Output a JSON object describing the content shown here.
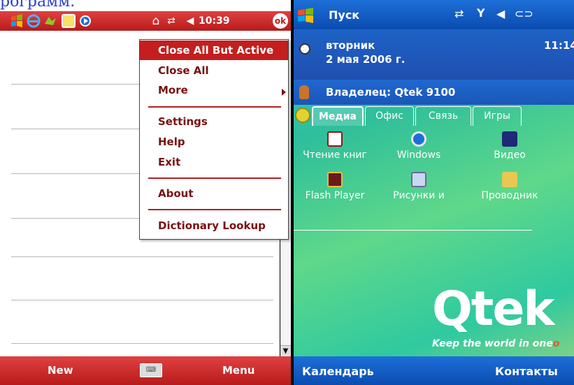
{
  "page_caption": "рограмм.",
  "left_device": {
    "status_bar": {
      "time": "10:39",
      "ok_label": "ok",
      "icons": [
        "windows-start-icon",
        "internet-explorer-icon",
        "mail-icon",
        "notes-icon",
        "media-player-icon",
        "home-icon",
        "sync-icon",
        "volume-icon"
      ]
    },
    "context_menu": {
      "items": [
        {
          "label": "Close All But Active"
        },
        {
          "label": "Close All"
        },
        {
          "label": "More"
        },
        {
          "label": "Settings"
        },
        {
          "label": "Help"
        },
        {
          "label": "Exit"
        },
        {
          "label": "About"
        },
        {
          "label": "Dictionary Lookup"
        }
      ]
    },
    "bottom_bar": {
      "left_softkey": "New",
      "right_softkey": "Menu"
    },
    "colors": {
      "accent": "#c41e1e",
      "menu_text": "#7a1010"
    }
  },
  "right_device": {
    "status_bar": {
      "start_label": "Пуск"
    },
    "today": {
      "weekday": "вторник",
      "date": "2 мая 2006 г.",
      "time": "11:14",
      "owner": "Владелец: Qtek 9100"
    },
    "tabs": [
      {
        "label": "Медиа"
      },
      {
        "label": "Офис"
      },
      {
        "label": "Связь"
      },
      {
        "label": "Игры"
      }
    ],
    "apps": [
      {
        "label": "Чтение книг",
        "icon": "book-reader-icon"
      },
      {
        "label": "Windows",
        "icon": "windows-media-icon"
      },
      {
        "label": "Видео",
        "icon": "video-icon"
      },
      {
        "label": "Flash Player",
        "icon": "flash-player-icon"
      },
      {
        "label": "Рисунки и",
        "icon": "pictures-icon"
      },
      {
        "label": "Проводник",
        "icon": "explorer-folder-icon"
      }
    ],
    "brand": {
      "logo": "Qtek",
      "slogan": "Keep the world in one",
      "slogan_mark": "o"
    },
    "bottom_bar": {
      "left_softkey": "Календарь",
      "right_softkey": "Контакты"
    },
    "colors": {
      "bar_blue": "#1d6fd8",
      "background_green": "#2fbf9a"
    }
  }
}
